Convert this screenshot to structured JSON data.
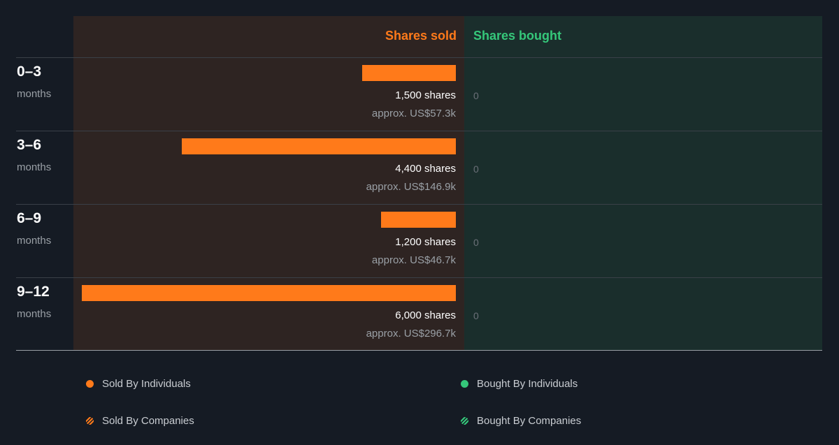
{
  "chart_data": {
    "type": "bar",
    "orientation": "horizontal",
    "headers": {
      "sold": "Shares sold",
      "bought": "Shares bought"
    },
    "categories": [
      {
        "period": "0–3",
        "unit": "months"
      },
      {
        "period": "3–6",
        "unit": "months"
      },
      {
        "period": "6–9",
        "unit": "months"
      },
      {
        "period": "9–12",
        "unit": "months"
      }
    ],
    "sold_values": [
      1500,
      4400,
      1200,
      6000
    ],
    "sold_labels": [
      "1,500 shares",
      "4,400 shares",
      "1,200 shares",
      "6,000 shares"
    ],
    "sold_approx": [
      "approx. US$57.3k",
      "approx. US$146.9k",
      "approx. US$46.7k",
      "approx. US$296.7k"
    ],
    "bought_values": [
      0,
      0,
      0,
      0
    ],
    "bought_labels": [
      "0",
      "0",
      "0",
      "0"
    ],
    "legend": [
      {
        "label": "Sold By Individuals",
        "color": "#ff7a1a",
        "style": "solid"
      },
      {
        "label": "Bought By Individuals",
        "color": "#35c77a",
        "style": "solid"
      },
      {
        "label": "Sold By Companies",
        "color": "#ff7a1a",
        "style": "striped"
      },
      {
        "label": "Bought By Companies",
        "color": "#35c77a",
        "style": "striped"
      }
    ],
    "colors": {
      "sold": "#ff7a1a",
      "bought": "#35c77a"
    }
  }
}
